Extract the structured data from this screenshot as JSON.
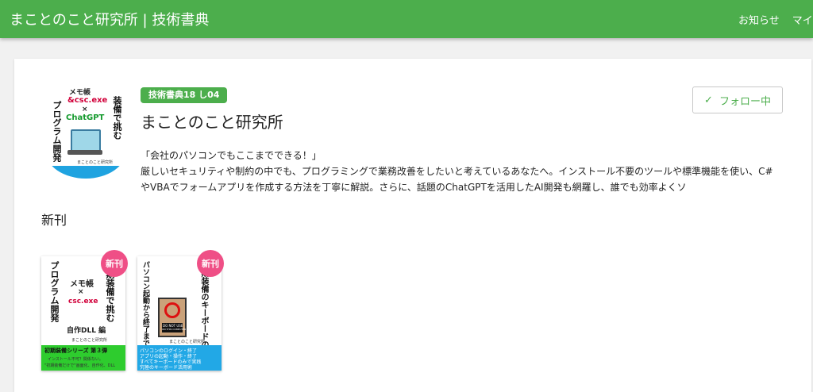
{
  "header": {
    "site_title": "まことのこと研究所 | 技術書典",
    "nav": [
      "お知らせ",
      "マイ"
    ]
  },
  "circle": {
    "tag": "技術書典18 し04",
    "name": "まことのこと研究所",
    "follow_label": "フォロー中",
    "description_lines": [
      "「会社のパソコンでもここまでできる！」",
      "厳しいセキュリティや制約の中でも、プログラミングで業務改善をしたいと考えているあなたへ。インストール不要のツールや標準機能を使い、C#",
      "やVBAでフォームアプリを作成する方法を丁寧に解説。さらに、話題のChatGPTを活用したAI開発も網羅し、誰でも効率よくソ"
    ],
    "cover": {
      "left_vertical": "プログラム開発",
      "right_vertical": "装備で挑む",
      "line1": "メモ帳",
      "line2": "&csc.exe",
      "line3": "×",
      "line4": "ChatGPT",
      "author": "まことのこと研究所"
    }
  },
  "new_releases": {
    "title": "新刊",
    "badge": "新刊",
    "books": [
      {
        "left_vertical": "プログラム開発",
        "right_vertical": "初期装備で挑む",
        "line1": "メモ帳",
        "line2": "×",
        "line3": "csc.exe",
        "edition": "自作DLL 編",
        "author": "まことのこと研究所",
        "series": "初期装備シリーズ 第３弾",
        "band1": "インストール不可？関係ない。",
        "band2": "\"初期装備だけで\"画面化、自作化、DLL"
      },
      {
        "left_vertical": "パソコン起動から終了まで",
        "right_vertical": "初期装備のキーボードのみで挑む",
        "sign1": "DO NOT USE",
        "sign2": "ON THIS COMPUTER",
        "author": "まことのこと研究所",
        "band1": "パソコンのログイン・終了",
        "band2": "アプリの起動・操作・終了",
        "band3": "すべてキーボードのみで実践",
        "band4": "究極のキーボード活用術"
      }
    ]
  }
}
